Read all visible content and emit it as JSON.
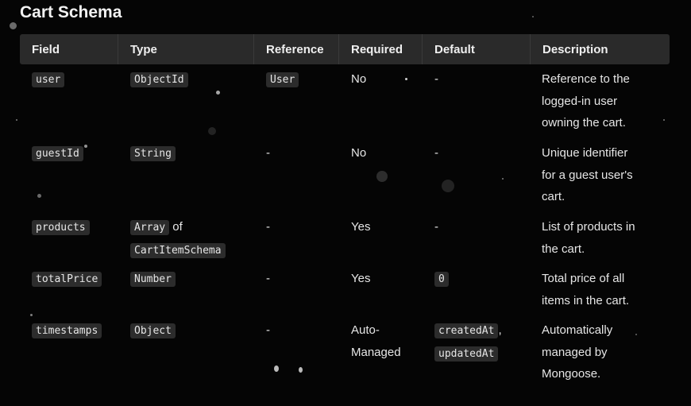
{
  "title": "Cart Schema",
  "headers": {
    "field": "Field",
    "type": "Type",
    "reference": "Reference",
    "required": "Required",
    "default": "Default",
    "description": "Description"
  },
  "rows": [
    {
      "field": "user",
      "type": "ObjectId",
      "type_suffix": "",
      "type_line2": "",
      "reference": "User",
      "required": [
        "No"
      ],
      "default": "-",
      "default_code": "",
      "default_code2": "",
      "description": [
        "Reference to the",
        "logged-in user",
        "owning the cart."
      ]
    },
    {
      "field": "guestId",
      "type": "String",
      "type_suffix": "",
      "type_line2": "",
      "reference": "-",
      "required": [
        "No"
      ],
      "default": "-",
      "default_code": "",
      "default_code2": "",
      "description": [
        "Unique identifier",
        "for a guest user's",
        "cart."
      ]
    },
    {
      "field": "products",
      "type": "Array",
      "type_suffix": " of",
      "type_line2": "CartItemSchema",
      "reference": "-",
      "required": [
        "Yes"
      ],
      "default": "-",
      "default_code": "",
      "default_code2": "",
      "description": [
        "List of products in",
        "the cart."
      ]
    },
    {
      "field": "totalPrice",
      "type": "Number",
      "type_suffix": "",
      "type_line2": "",
      "reference": "-",
      "required": [
        "Yes"
      ],
      "default": "",
      "default_code": "0",
      "default_code2": "",
      "description": [
        "Total price of all",
        "items in the cart."
      ]
    },
    {
      "field": "timestamps",
      "type": "Object",
      "type_suffix": "",
      "type_line2": "",
      "reference": "-",
      "required": [
        "Auto-",
        "Managed"
      ],
      "default": "",
      "default_code": "createdAt",
      "default_code2": "updatedAt",
      "description": [
        "Automatically",
        "managed by",
        "Mongoose."
      ]
    }
  ]
}
